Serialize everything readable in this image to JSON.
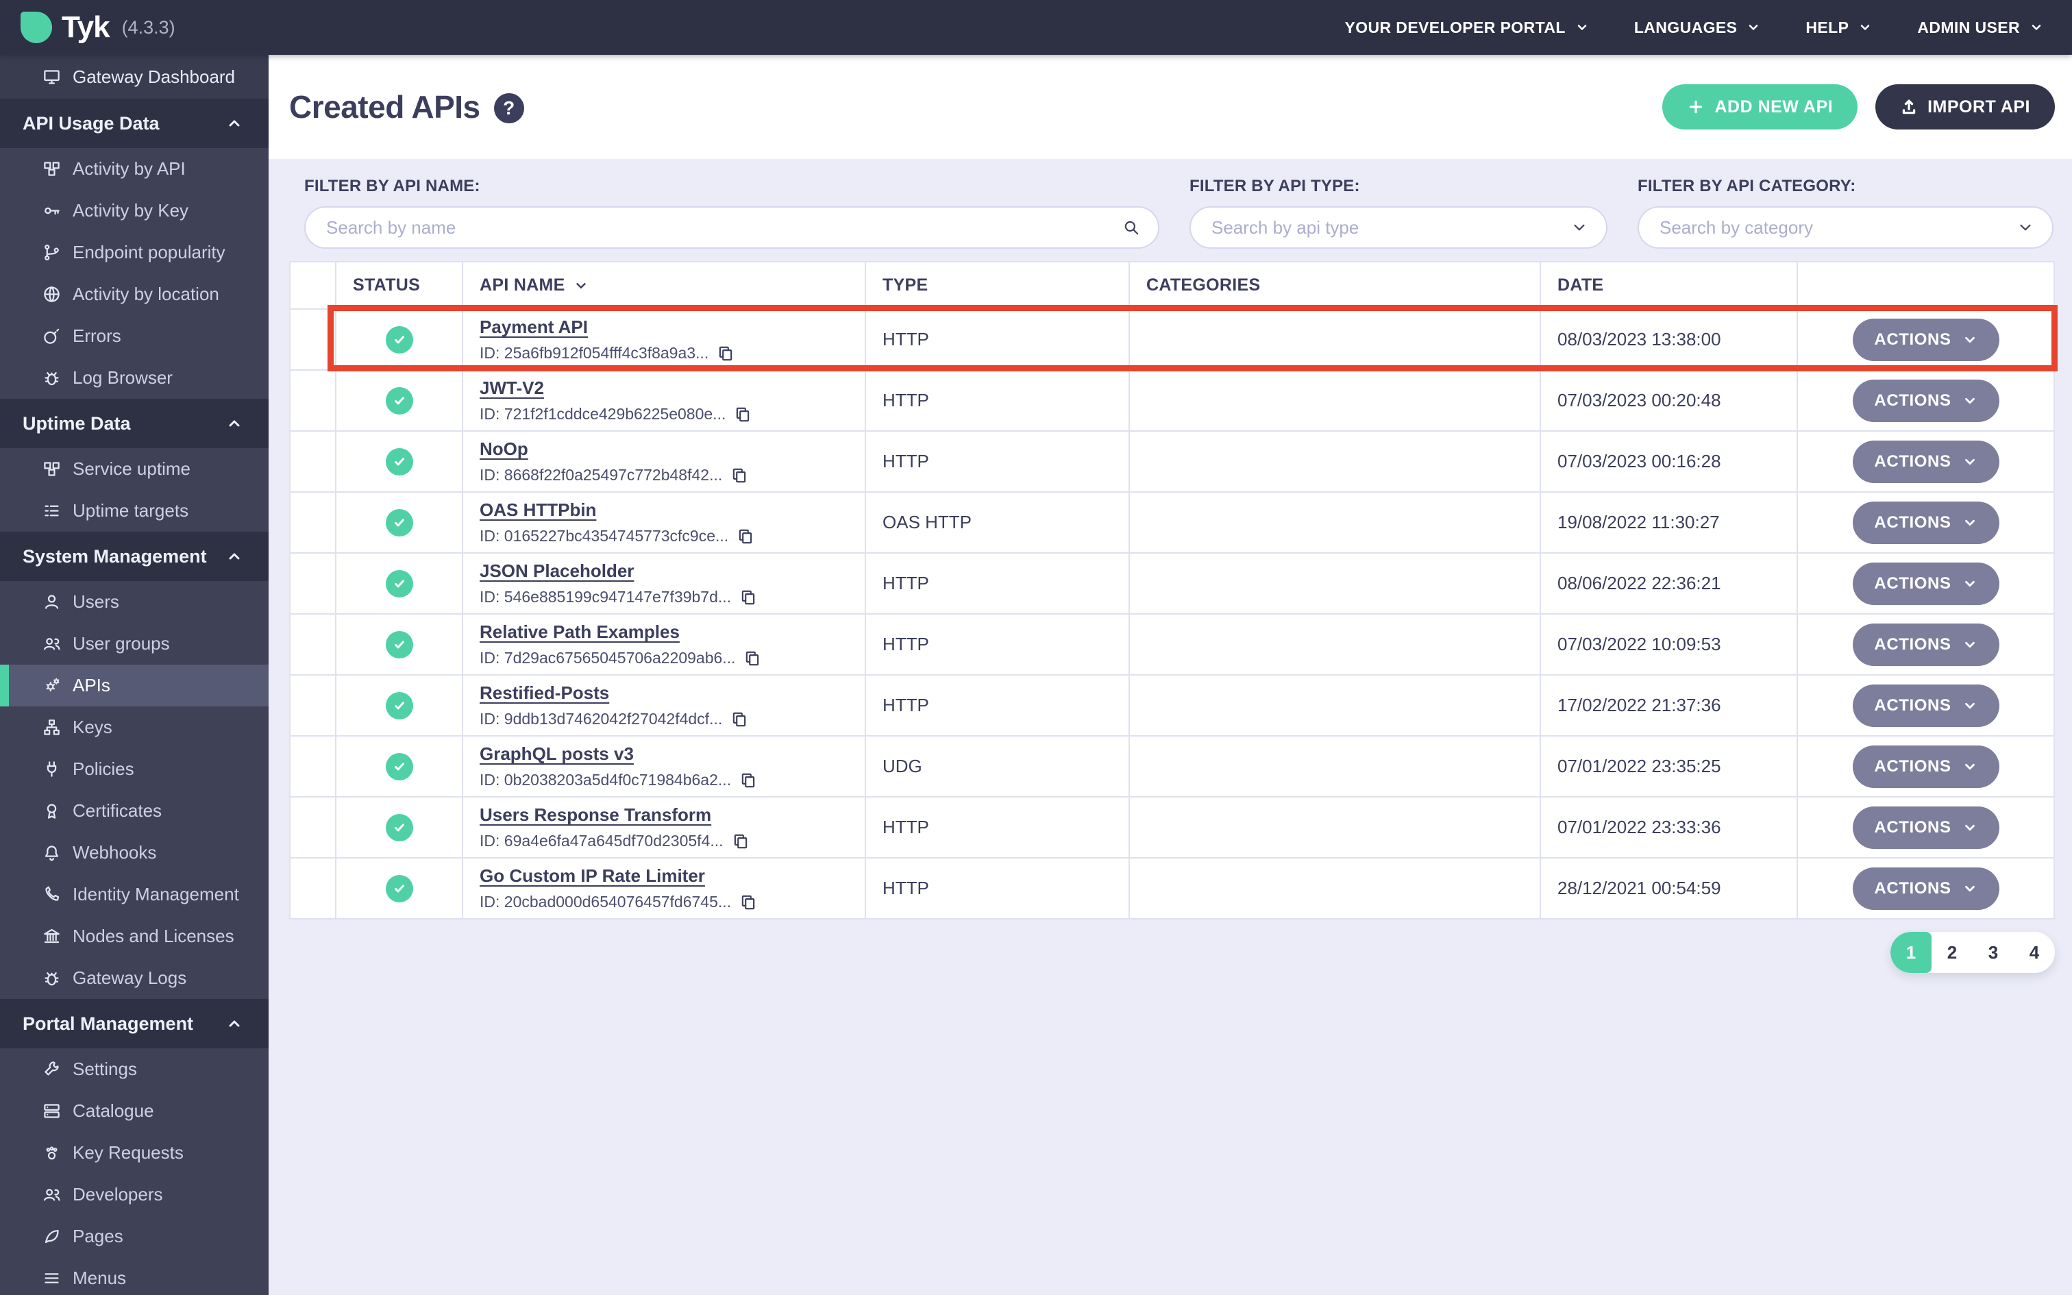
{
  "colors": {
    "teal": "#4fd1a5",
    "topbar": "#2e3044",
    "sidebg": "#3f4156",
    "sideactive": "#575a74",
    "contentbg": "#ebecf7",
    "text": "#3b3e5c",
    "actions": "#7c7e9b",
    "red": "#e8432c",
    "btndark": "#33354a"
  },
  "topbar": {
    "logo_text": "Tyk",
    "version": "(4.3.3)",
    "menus": [
      {
        "label": "YOUR DEVELOPER PORTAL"
      },
      {
        "label": "LANGUAGES"
      },
      {
        "label": "HELP"
      },
      {
        "label": "ADMIN USER"
      }
    ]
  },
  "sidebar": {
    "top_item": {
      "label": "Gateway Dashboard",
      "icon": "monitor-icon"
    },
    "sections": [
      {
        "label": "API Usage Data",
        "items": [
          {
            "label": "Activity by API",
            "icon": "cubes-icon"
          },
          {
            "label": "Activity by Key",
            "icon": "key-icon"
          },
          {
            "label": "Endpoint popularity",
            "icon": "branch-icon"
          },
          {
            "label": "Activity by location",
            "icon": "globe-icon"
          },
          {
            "label": "Errors",
            "icon": "bomb-icon"
          },
          {
            "label": "Log Browser",
            "icon": "bug-icon"
          }
        ]
      },
      {
        "label": "Uptime Data",
        "items": [
          {
            "label": "Service uptime",
            "icon": "cubes-icon"
          },
          {
            "label": "Uptime targets",
            "icon": "list-icon"
          }
        ]
      },
      {
        "label": "System Management",
        "items": [
          {
            "label": "Users",
            "icon": "user-icon"
          },
          {
            "label": "User groups",
            "icon": "users-icon"
          },
          {
            "label": "APIs",
            "icon": "gears-icon",
            "active": true
          },
          {
            "label": "Keys",
            "icon": "sitemap-icon"
          },
          {
            "label": "Policies",
            "icon": "plug-icon"
          },
          {
            "label": "Certificates",
            "icon": "certificate-icon"
          },
          {
            "label": "Webhooks",
            "icon": "bell-icon"
          },
          {
            "label": "Identity Management",
            "icon": "phone-icon"
          },
          {
            "label": "Nodes and Licenses",
            "icon": "bank-icon"
          },
          {
            "label": "Gateway Logs",
            "icon": "bug-icon"
          }
        ]
      },
      {
        "label": "Portal Management",
        "items": [
          {
            "label": "Settings",
            "icon": "wrench-icon"
          },
          {
            "label": "Catalogue",
            "icon": "server-icon"
          },
          {
            "label": "Key Requests",
            "icon": "paw-icon"
          },
          {
            "label": "Developers",
            "icon": "users-icon"
          },
          {
            "label": "Pages",
            "icon": "leaf-icon"
          },
          {
            "label": "Menus",
            "icon": "bars-icon"
          }
        ]
      }
    ]
  },
  "page": {
    "title": "Created APIs",
    "help_glyph": "?",
    "add_button": "ADD NEW API",
    "import_button": "IMPORT API"
  },
  "filters": [
    {
      "label": "FILTER BY API NAME:",
      "placeholder": "Search by name",
      "control": "search"
    },
    {
      "label": "FILTER BY API TYPE:",
      "placeholder": "Search by api type",
      "control": "select"
    },
    {
      "label": "FILTER BY API CATEGORY:",
      "placeholder": "Search by category",
      "control": "select"
    }
  ],
  "table": {
    "columns": [
      {
        "label": "",
        "sortable": false
      },
      {
        "label": "STATUS",
        "sortable": false
      },
      {
        "label": "API NAME",
        "sortable": true
      },
      {
        "label": "TYPE",
        "sortable": false
      },
      {
        "label": "CATEGORIES",
        "sortable": false
      },
      {
        "label": "DATE",
        "sortable": false
      },
      {
        "label": "",
        "sortable": false
      }
    ],
    "actions_label": "ACTIONS",
    "rows": [
      {
        "name": "Payment API",
        "id": "ID: 25a6fb912f054fff4c3f8a9a3...",
        "type": "HTTP",
        "categories": "",
        "date": "08/03/2023 13:38:00",
        "highlighted": true
      },
      {
        "name": "JWT-V2",
        "id": "ID: 721f2f1cddce429b6225e080e...",
        "type": "HTTP",
        "categories": "",
        "date": "07/03/2023 00:20:48"
      },
      {
        "name": "NoOp",
        "id": "ID: 8668f22f0a25497c772b48f42...",
        "type": "HTTP",
        "categories": "",
        "date": "07/03/2023 00:16:28"
      },
      {
        "name": "OAS HTTPbin",
        "id": "ID: 0165227bc4354745773cfc9ce...",
        "type": "OAS HTTP",
        "categories": "",
        "date": "19/08/2022 11:30:27"
      },
      {
        "name": "JSON Placeholder",
        "id": "ID: 546e885199c947147e7f39b7d...",
        "type": "HTTP",
        "categories": "",
        "date": "08/06/2022 22:36:21"
      },
      {
        "name": "Relative Path Examples",
        "id": "ID: 7d29ac67565045706a2209ab6...",
        "type": "HTTP",
        "categories": "",
        "date": "07/03/2022 10:09:53"
      },
      {
        "name": "Restified-Posts",
        "id": "ID: 9ddb13d7462042f27042f4dcf...",
        "type": "HTTP",
        "categories": "",
        "date": "17/02/2022 21:37:36"
      },
      {
        "name": "GraphQL posts v3",
        "id": "ID: 0b2038203a5d4f0c71984b6a2...",
        "type": "UDG",
        "categories": "",
        "date": "07/01/2022 23:35:25"
      },
      {
        "name": "Users Response Transform",
        "id": "ID: 69a4e6fa47a645df70d2305f4...",
        "type": "HTTP",
        "categories": "",
        "date": "07/01/2022 23:33:36"
      },
      {
        "name": "Go Custom IP Rate Limiter",
        "id": "ID: 20cbad000d654076457fd6745...",
        "type": "HTTP",
        "categories": "",
        "date": "28/12/2021 00:54:59"
      }
    ]
  },
  "pagination": {
    "pages": [
      "1",
      "2",
      "3",
      "4"
    ],
    "active": "1"
  }
}
